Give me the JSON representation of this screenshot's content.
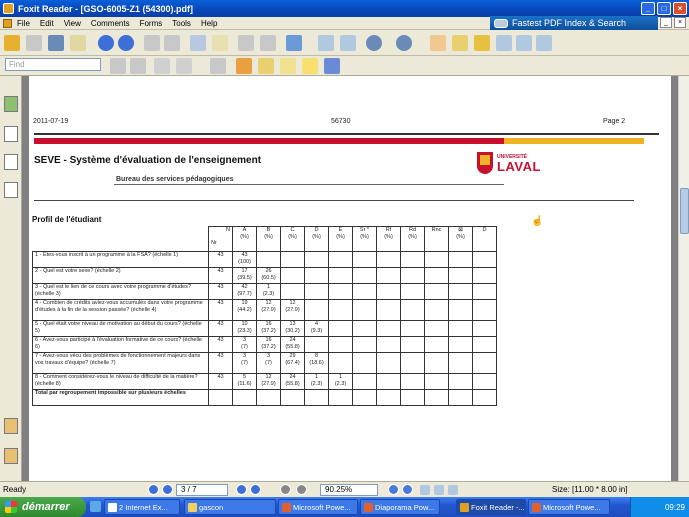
{
  "window": {
    "title": "Foxit Reader - [GSO-6005-Z1 (54300).pdf]",
    "controls": [
      "_",
      "□",
      "×"
    ]
  },
  "menu": [
    "File",
    "Edit",
    "View",
    "Comments",
    "Forms",
    "Tools",
    "Help"
  ],
  "promo": "Fastest PDF Index & Search",
  "find_placeholder": "Find",
  "document": {
    "header_date": "2011-07-19",
    "header_code": "56730",
    "header_page": "Page  2",
    "seve_title": "SEVE - Système d'évaluation de l'enseignement",
    "seve_subtitle": "Bureau des services pédagogiques",
    "logo_small": "UNIVERSITÉ",
    "logo_big": "LAVAL",
    "section_title": "Profil de l'étudiant",
    "table": {
      "corner_n": "N",
      "corner_nr": "Nr",
      "columns": [
        {
          "letter": "A",
          "unit": "(%)"
        },
        {
          "letter": "B",
          "unit": "(%)"
        },
        {
          "letter": "C",
          "unit": "(%)"
        },
        {
          "letter": "D",
          "unit": "(%)"
        },
        {
          "letter": "E",
          "unit": "(%)"
        },
        {
          "letter": "Sr *",
          "unit": "(%)"
        },
        {
          "letter": "Rf",
          "unit": "(%)"
        },
        {
          "letter": "Rd",
          "unit": "(%)"
        },
        {
          "letter": "Rnc",
          "unit": ""
        },
        {
          "letter": "⊠",
          "unit": "(%)"
        },
        {
          "letter": "D",
          "unit": ""
        }
      ],
      "rows": [
        {
          "q": "1 - Êtes-vous inscrit à un programme à la FSA? (échelle 1)",
          "n": "43",
          "cells": [
            [
              "43",
              "(100)"
            ],
            [
              "",
              ""
            ],
            [
              "",
              ""
            ],
            [
              "",
              ""
            ],
            [
              "",
              ""
            ],
            [
              "",
              ""
            ],
            [
              "",
              ""
            ],
            [
              "",
              ""
            ],
            [
              "",
              ""
            ],
            [
              "",
              ""
            ],
            [
              "",
              ""
            ]
          ]
        },
        {
          "q": "2 - Quel est votre sexe? (échelle 2)",
          "n": "43",
          "cells": [
            [
              "17",
              "(39.5)"
            ],
            [
              "26",
              "(60.5)"
            ],
            [
              "",
              ""
            ],
            [
              "",
              ""
            ],
            [
              "",
              ""
            ],
            [
              "",
              ""
            ],
            [
              "",
              ""
            ],
            [
              "",
              ""
            ],
            [
              "",
              ""
            ],
            [
              "",
              ""
            ],
            [
              "",
              ""
            ]
          ]
        },
        {
          "q": "3 - Quel est le lien de ce cours avec votre programme d'études? (échelle 3)",
          "n": "43",
          "cells": [
            [
              "42",
              "(97.7)"
            ],
            [
              "1",
              "(2.3)"
            ],
            [
              "",
              ""
            ],
            [
              "",
              ""
            ],
            [
              "",
              ""
            ],
            [
              "",
              ""
            ],
            [
              "",
              ""
            ],
            [
              "",
              ""
            ],
            [
              "",
              ""
            ],
            [
              "",
              ""
            ],
            [
              "",
              ""
            ]
          ]
        },
        {
          "q": "4 - Combien de crédits aviez-vous accumulés dans votre programme d'études à la fin de la session passée? (échelle 4)",
          "n": "43",
          "cells": [
            [
              "19",
              "(44.2)"
            ],
            [
              "12",
              "(27.9)"
            ],
            [
              "12",
              "(27.9)"
            ],
            [
              "",
              ""
            ],
            [
              "",
              ""
            ],
            [
              "",
              ""
            ],
            [
              "",
              ""
            ],
            [
              "",
              ""
            ],
            [
              "",
              ""
            ],
            [
              "",
              ""
            ],
            [
              "",
              ""
            ]
          ]
        },
        {
          "q": "5 - Quel était votre niveau de motivation au début du cours? (échelle 5)",
          "n": "43",
          "cells": [
            [
              "10",
              "(23.3)"
            ],
            [
              "16",
              "(37.2)"
            ],
            [
              "13",
              "(30.2)"
            ],
            [
              "4",
              "(9.3)"
            ],
            [
              "",
              ""
            ],
            [
              "",
              ""
            ],
            [
              "",
              ""
            ],
            [
              "",
              ""
            ],
            [
              "",
              ""
            ],
            [
              "",
              ""
            ],
            [
              "",
              ""
            ]
          ]
        },
        {
          "q": "6 - Avez-vous participé à l'évaluation formative de ce cours? (échelle 6)",
          "n": "43",
          "cells": [
            [
              "3",
              "(7)"
            ],
            [
              "16",
              "(37.2)"
            ],
            [
              "24",
              "(55.8)"
            ],
            [
              "",
              ""
            ],
            [
              "",
              ""
            ],
            [
              "",
              ""
            ],
            [
              "",
              ""
            ],
            [
              "",
              ""
            ],
            [
              "",
              ""
            ],
            [
              "",
              ""
            ],
            [
              "",
              ""
            ]
          ]
        },
        {
          "q": "7 - Avez-vous vécu des problèmes de fonctionnement majeurs dans vos travaux d'équipe? (échelle 7)",
          "n": "43",
          "cells": [
            [
              "3",
              "(7)"
            ],
            [
              "3",
              "(7)"
            ],
            [
              "29",
              "(67.4)"
            ],
            [
              "8",
              "(18.6)"
            ],
            [
              "",
              ""
            ],
            [
              "",
              ""
            ],
            [
              "",
              ""
            ],
            [
              "",
              ""
            ],
            [
              "",
              ""
            ],
            [
              "",
              ""
            ],
            [
              "",
              ""
            ]
          ]
        },
        {
          "q": "8 - Comment considérez-vous le niveau de difficulté de la matière? (échelle 8)",
          "n": "43",
          "cells": [
            [
              "5",
              "(11.6)"
            ],
            [
              "12",
              "(27.9)"
            ],
            [
              "24",
              "(55.8)"
            ],
            [
              "1",
              "(2.3)"
            ],
            [
              "1",
              "(2.3)"
            ],
            [
              "",
              ""
            ],
            [
              "",
              ""
            ],
            [
              "",
              ""
            ],
            [
              "",
              ""
            ],
            [
              "",
              ""
            ],
            [
              "",
              ""
            ]
          ]
        },
        {
          "q": "Total par regroupement impossible sur plusieurs échelles",
          "n": "",
          "cells": [
            [
              "",
              ""
            ],
            [
              "",
              ""
            ],
            [
              "",
              ""
            ],
            [
              "",
              ""
            ],
            [
              "",
              ""
            ],
            [
              "",
              ""
            ],
            [
              "",
              ""
            ],
            [
              "",
              ""
            ],
            [
              "",
              ""
            ],
            [
              "",
              ""
            ],
            [
              "",
              ""
            ]
          ]
        }
      ]
    }
  },
  "status": {
    "ready": "Ready",
    "page": "3 / 7",
    "zoom": "90.25%",
    "size": "Size: [11.00 * 8.00 in]"
  },
  "taskbar": {
    "start": "démarrer",
    "tasks": [
      "2 Internet Ex...",
      "gascon",
      "Microsoft Powe...",
      "Diaporama Pow...",
      "Foxit Reader -...",
      "Microsoft Powe..."
    ],
    "clock": "09:29"
  },
  "colors": {
    "laval_red": "#c8102e",
    "laval_gold": "#f0b323",
    "titlebar_blue": "#0846b8"
  }
}
